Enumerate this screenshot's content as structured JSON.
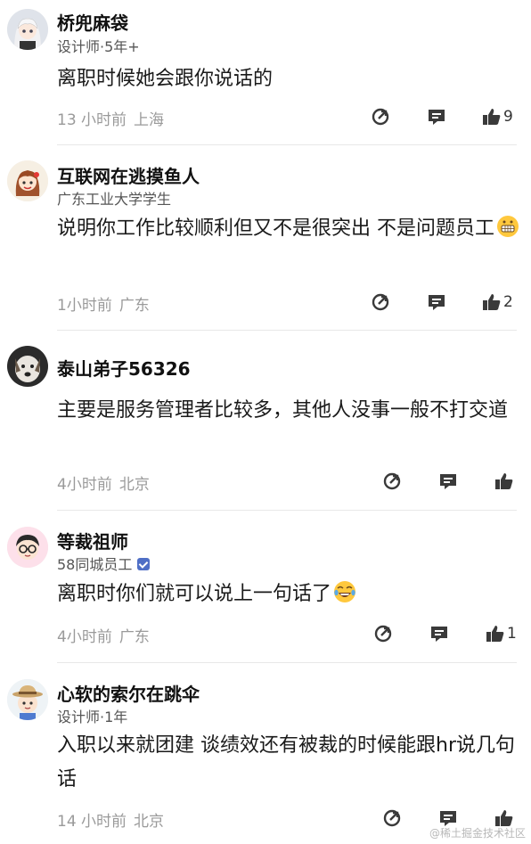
{
  "comments": [
    {
      "name": "桥兜麻袋",
      "subtitle": "设计师·5年+",
      "verified": false,
      "body": "离职时候她会跟你说话的",
      "emoji": "",
      "time": "13 小时前",
      "location": "上海",
      "likes": "9",
      "avatar_icon": "anime-girl-avatar"
    },
    {
      "name": "互联网在逃摸鱼人",
      "subtitle": "广东工业大学学生",
      "verified": false,
      "body": "说明你工作比较顺利但又不是很突出 不是问题员工",
      "emoji": "grimace-emoji",
      "time": "1小时前",
      "location": "广东",
      "likes": "2",
      "avatar_icon": "braided-girl-avatar"
    },
    {
      "name": "泰山弟子56326",
      "subtitle": "",
      "verified": false,
      "body": "主要是服务管理者比较多，其他人没事一般不打交道",
      "emoji": "",
      "time": "4小时前",
      "location": "北京",
      "likes": "",
      "avatar_icon": "dog-avatar"
    },
    {
      "name": "等裁祖师",
      "subtitle": "58同城员工",
      "verified": true,
      "body": "离职时你们就可以说上一句话了",
      "emoji": "tears-of-joy-emoji",
      "time": "4小时前",
      "location": "广东",
      "likes": "1",
      "avatar_icon": "glasses-boy-avatar"
    },
    {
      "name": "心软的索尔在跳伞",
      "subtitle": "设计师·1年",
      "verified": false,
      "body": "入职以来就团建 谈绩效还有被裁的时候能跟hr说几句话",
      "emoji": "",
      "time": "14 小时前",
      "location": "北京",
      "likes": "",
      "avatar_icon": "hat-boy-avatar"
    }
  ],
  "watermark": "@稀土掘金技术社区",
  "colors": {
    "meta": "#9a9a9a",
    "icon": "#3a3a3a",
    "badge": "#4f6fc6",
    "divider": "#e8e8e8"
  }
}
